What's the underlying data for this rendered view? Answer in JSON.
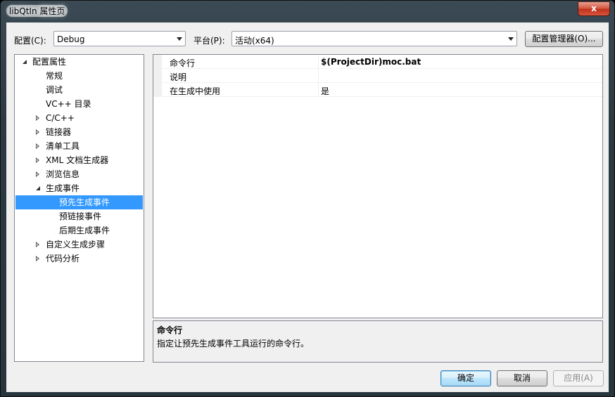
{
  "window": {
    "title": "libQtIn 属性页",
    "close_label": "x"
  },
  "toolbar": {
    "config_label": "配置(C):",
    "config_value": "Debug",
    "platform_label": "平台(P):",
    "platform_value": "活动(x64)",
    "config_manager_label": "配置管理器(O)..."
  },
  "tree": {
    "items": [
      {
        "label": "配置属性",
        "expander": "open"
      },
      {
        "label": "常规",
        "expander": "none"
      },
      {
        "label": "调试",
        "expander": "none"
      },
      {
        "label": "VC++ 目录",
        "expander": "none"
      },
      {
        "label": "C/C++",
        "expander": "closed"
      },
      {
        "label": "链接器",
        "expander": "closed"
      },
      {
        "label": "清单工具",
        "expander": "closed"
      },
      {
        "label": "XML 文档生成器",
        "expander": "closed"
      },
      {
        "label": "浏览信息",
        "expander": "closed"
      },
      {
        "label": "生成事件",
        "expander": "open"
      },
      {
        "label": "预先生成事件",
        "expander": "none",
        "selected": true
      },
      {
        "label": "预链接事件",
        "expander": "none"
      },
      {
        "label": "后期生成事件",
        "expander": "none"
      },
      {
        "label": "自定义生成步骤",
        "expander": "closed"
      },
      {
        "label": "代码分析",
        "expander": "closed"
      }
    ]
  },
  "properties": {
    "rows": [
      {
        "name": "命令行",
        "value": "$(ProjectDir)moc.bat",
        "bold": true
      },
      {
        "name": "说明",
        "value": ""
      },
      {
        "name": "在生成中使用",
        "value": "是"
      }
    ]
  },
  "description": {
    "title": "命令行",
    "text": "指定让预先生成事件工具运行的命令行。"
  },
  "buttons": {
    "ok": "确定",
    "cancel": "取消",
    "apply": "应用(A)"
  },
  "colors": {
    "selection": "#3399ff",
    "dialog_bg": "#f0f0f0"
  }
}
